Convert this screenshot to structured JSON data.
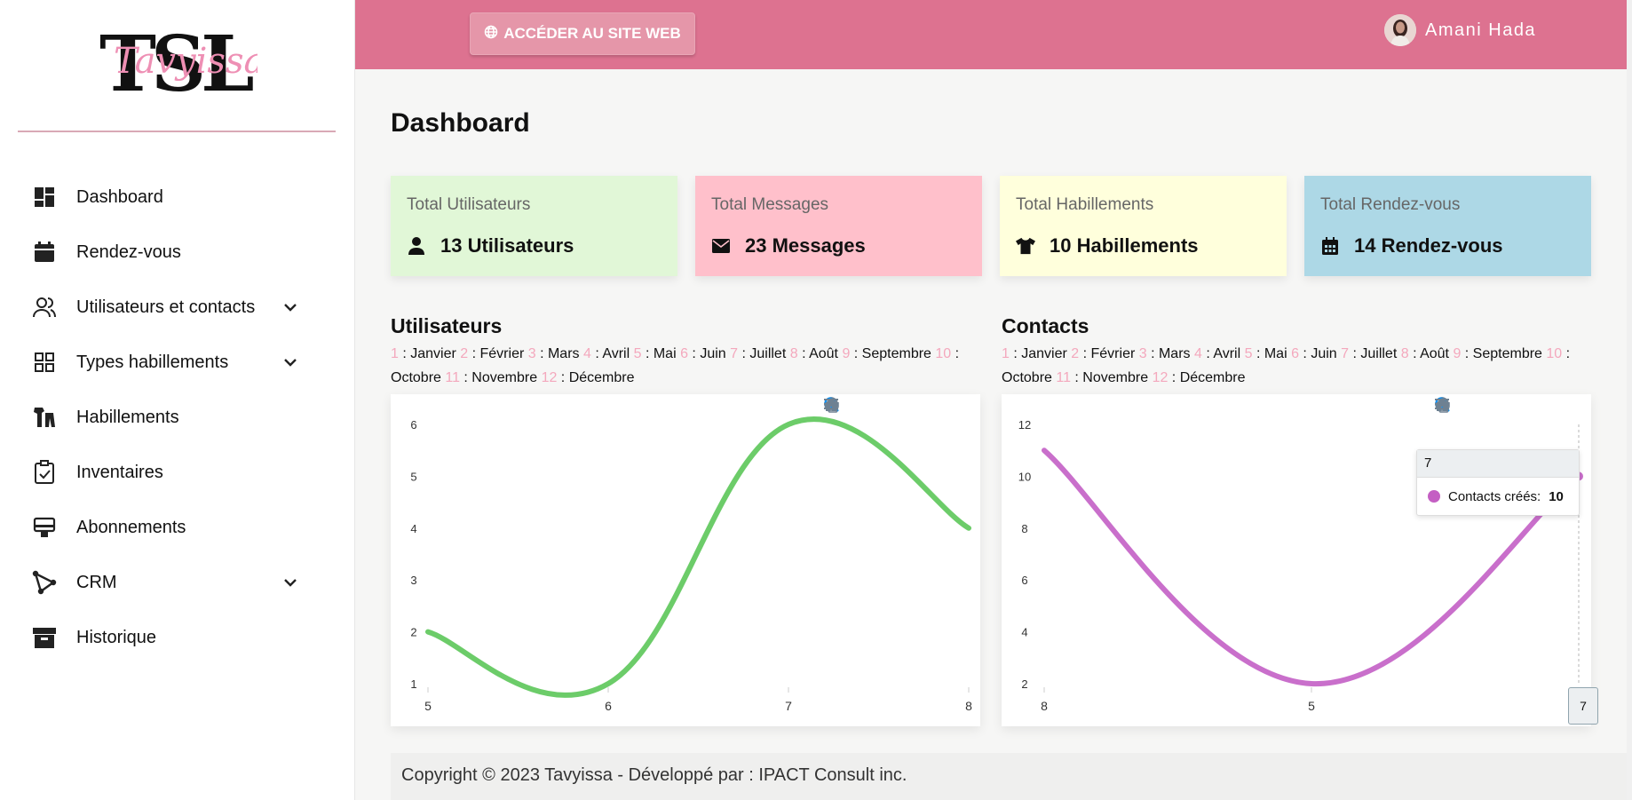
{
  "brand": {
    "logo_letters": "TSL",
    "logo_script": "Tavyissa"
  },
  "sidebar": {
    "items": [
      {
        "label": "Dashboard",
        "icon": "dashboard-icon",
        "has_submenu": false
      },
      {
        "label": "Rendez-vous",
        "icon": "calendar-icon",
        "has_submenu": false
      },
      {
        "label": "Utilisateurs et contacts",
        "icon": "users-icon",
        "has_submenu": true
      },
      {
        "label": "Types habillements",
        "icon": "grid-icon",
        "has_submenu": true
      },
      {
        "label": "Habillements",
        "icon": "clothes-icon",
        "has_submenu": false
      },
      {
        "label": "Inventaires",
        "icon": "clipboard-check-icon",
        "has_submenu": false
      },
      {
        "label": "Abonnements",
        "icon": "subscription-icon",
        "has_submenu": false
      },
      {
        "label": "CRM",
        "icon": "crm-icon",
        "has_submenu": true
      },
      {
        "label": "Historique",
        "icon": "archive-icon",
        "has_submenu": false
      }
    ]
  },
  "header": {
    "site_button": "ACCÉDER AU SITE WEB",
    "user_name": "Amani Hada"
  },
  "main": {
    "title": "Dashboard",
    "cards": [
      {
        "title": "Total Utilisateurs",
        "value": "13 Utilisateurs",
        "icon": "user-icon",
        "color": "#e1f7d7"
      },
      {
        "title": "Total Messages",
        "value": "23 Messages",
        "icon": "envelope-icon",
        "color": "#ffc0cb"
      },
      {
        "title": "Total Habillements",
        "value": "10 Habillements",
        "icon": "tshirt-icon",
        "color": "#ffffdc"
      },
      {
        "title": "Total Rendez-vous",
        "value": "14 Rendez-vous",
        "icon": "calendar-icon",
        "color": "#add8e6"
      }
    ],
    "months_legend": [
      {
        "n": "1",
        "name": "Janvier"
      },
      {
        "n": "2",
        "name": "Février"
      },
      {
        "n": "3",
        "name": "Mars"
      },
      {
        "n": "4",
        "name": "Avril"
      },
      {
        "n": "5",
        "name": "Mai"
      },
      {
        "n": "6",
        "name": "Juin"
      },
      {
        "n": "7",
        "name": "Juillet"
      },
      {
        "n": "8",
        "name": "Août"
      },
      {
        "n": "9",
        "name": "Septembre"
      },
      {
        "n": "10",
        "name": "Octobre"
      },
      {
        "n": "11",
        "name": "Novembre"
      },
      {
        "n": "12",
        "name": "Décembre"
      }
    ],
    "tooltip": {
      "header": "7",
      "series_label": "Contacts créés:",
      "value": "10"
    },
    "x_crosshair_label": "7"
  },
  "chart_data": [
    {
      "type": "line",
      "title": "Utilisateurs",
      "categories": [
        "5",
        "6",
        "7",
        "8"
      ],
      "series": [
        {
          "values": [
            2,
            1,
            6,
            4
          ],
          "color": "#6ccc69"
        }
      ],
      "ylim": [
        1,
        6
      ],
      "yticks": [
        1,
        2,
        3,
        4,
        5,
        6
      ]
    },
    {
      "type": "line",
      "title": "Contacts",
      "categories": [
        "8",
        "5",
        "7"
      ],
      "series": [
        {
          "name": "Contacts créés",
          "values": [
            11,
            2,
            10
          ],
          "color": "#c96fcb"
        }
      ],
      "ylim": [
        2,
        12
      ],
      "yticks": [
        2,
        4,
        6,
        8,
        10,
        12
      ]
    }
  ],
  "footer": {
    "text": "Copyright © 2023 Tavyissa - Développé par : IPACT Consult inc."
  }
}
